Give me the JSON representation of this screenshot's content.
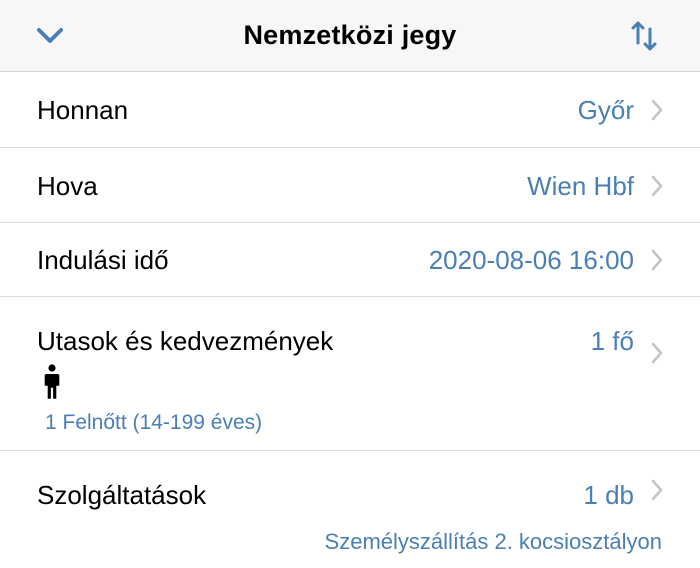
{
  "header": {
    "title": "Nemzetközi jegy",
    "back_icon": "chevron-down-icon",
    "swap_icon": "swap-vertical-arrows-icon"
  },
  "rows": [
    {
      "label": "Honnan",
      "value": "Győr"
    },
    {
      "label": "Hova",
      "value": "Wien Hbf"
    },
    {
      "label": "Indulási idő",
      "value": "2020-08-06 16:00"
    },
    {
      "label": "Utasok és kedvezmények",
      "value": "1 fő",
      "icon": "person-icon",
      "detail": "1 Felnőtt (14-199 éves)"
    },
    {
      "label": "Szolgáltatások",
      "value": "1 db",
      "detail": "Személyszállítás 2. kocsiosztályon"
    }
  ],
  "colors": {
    "accent": "#4a7fb5",
    "header_bg": "#f7f7f8",
    "separator": "#dadadc",
    "chevron": "#c4c4c7"
  }
}
